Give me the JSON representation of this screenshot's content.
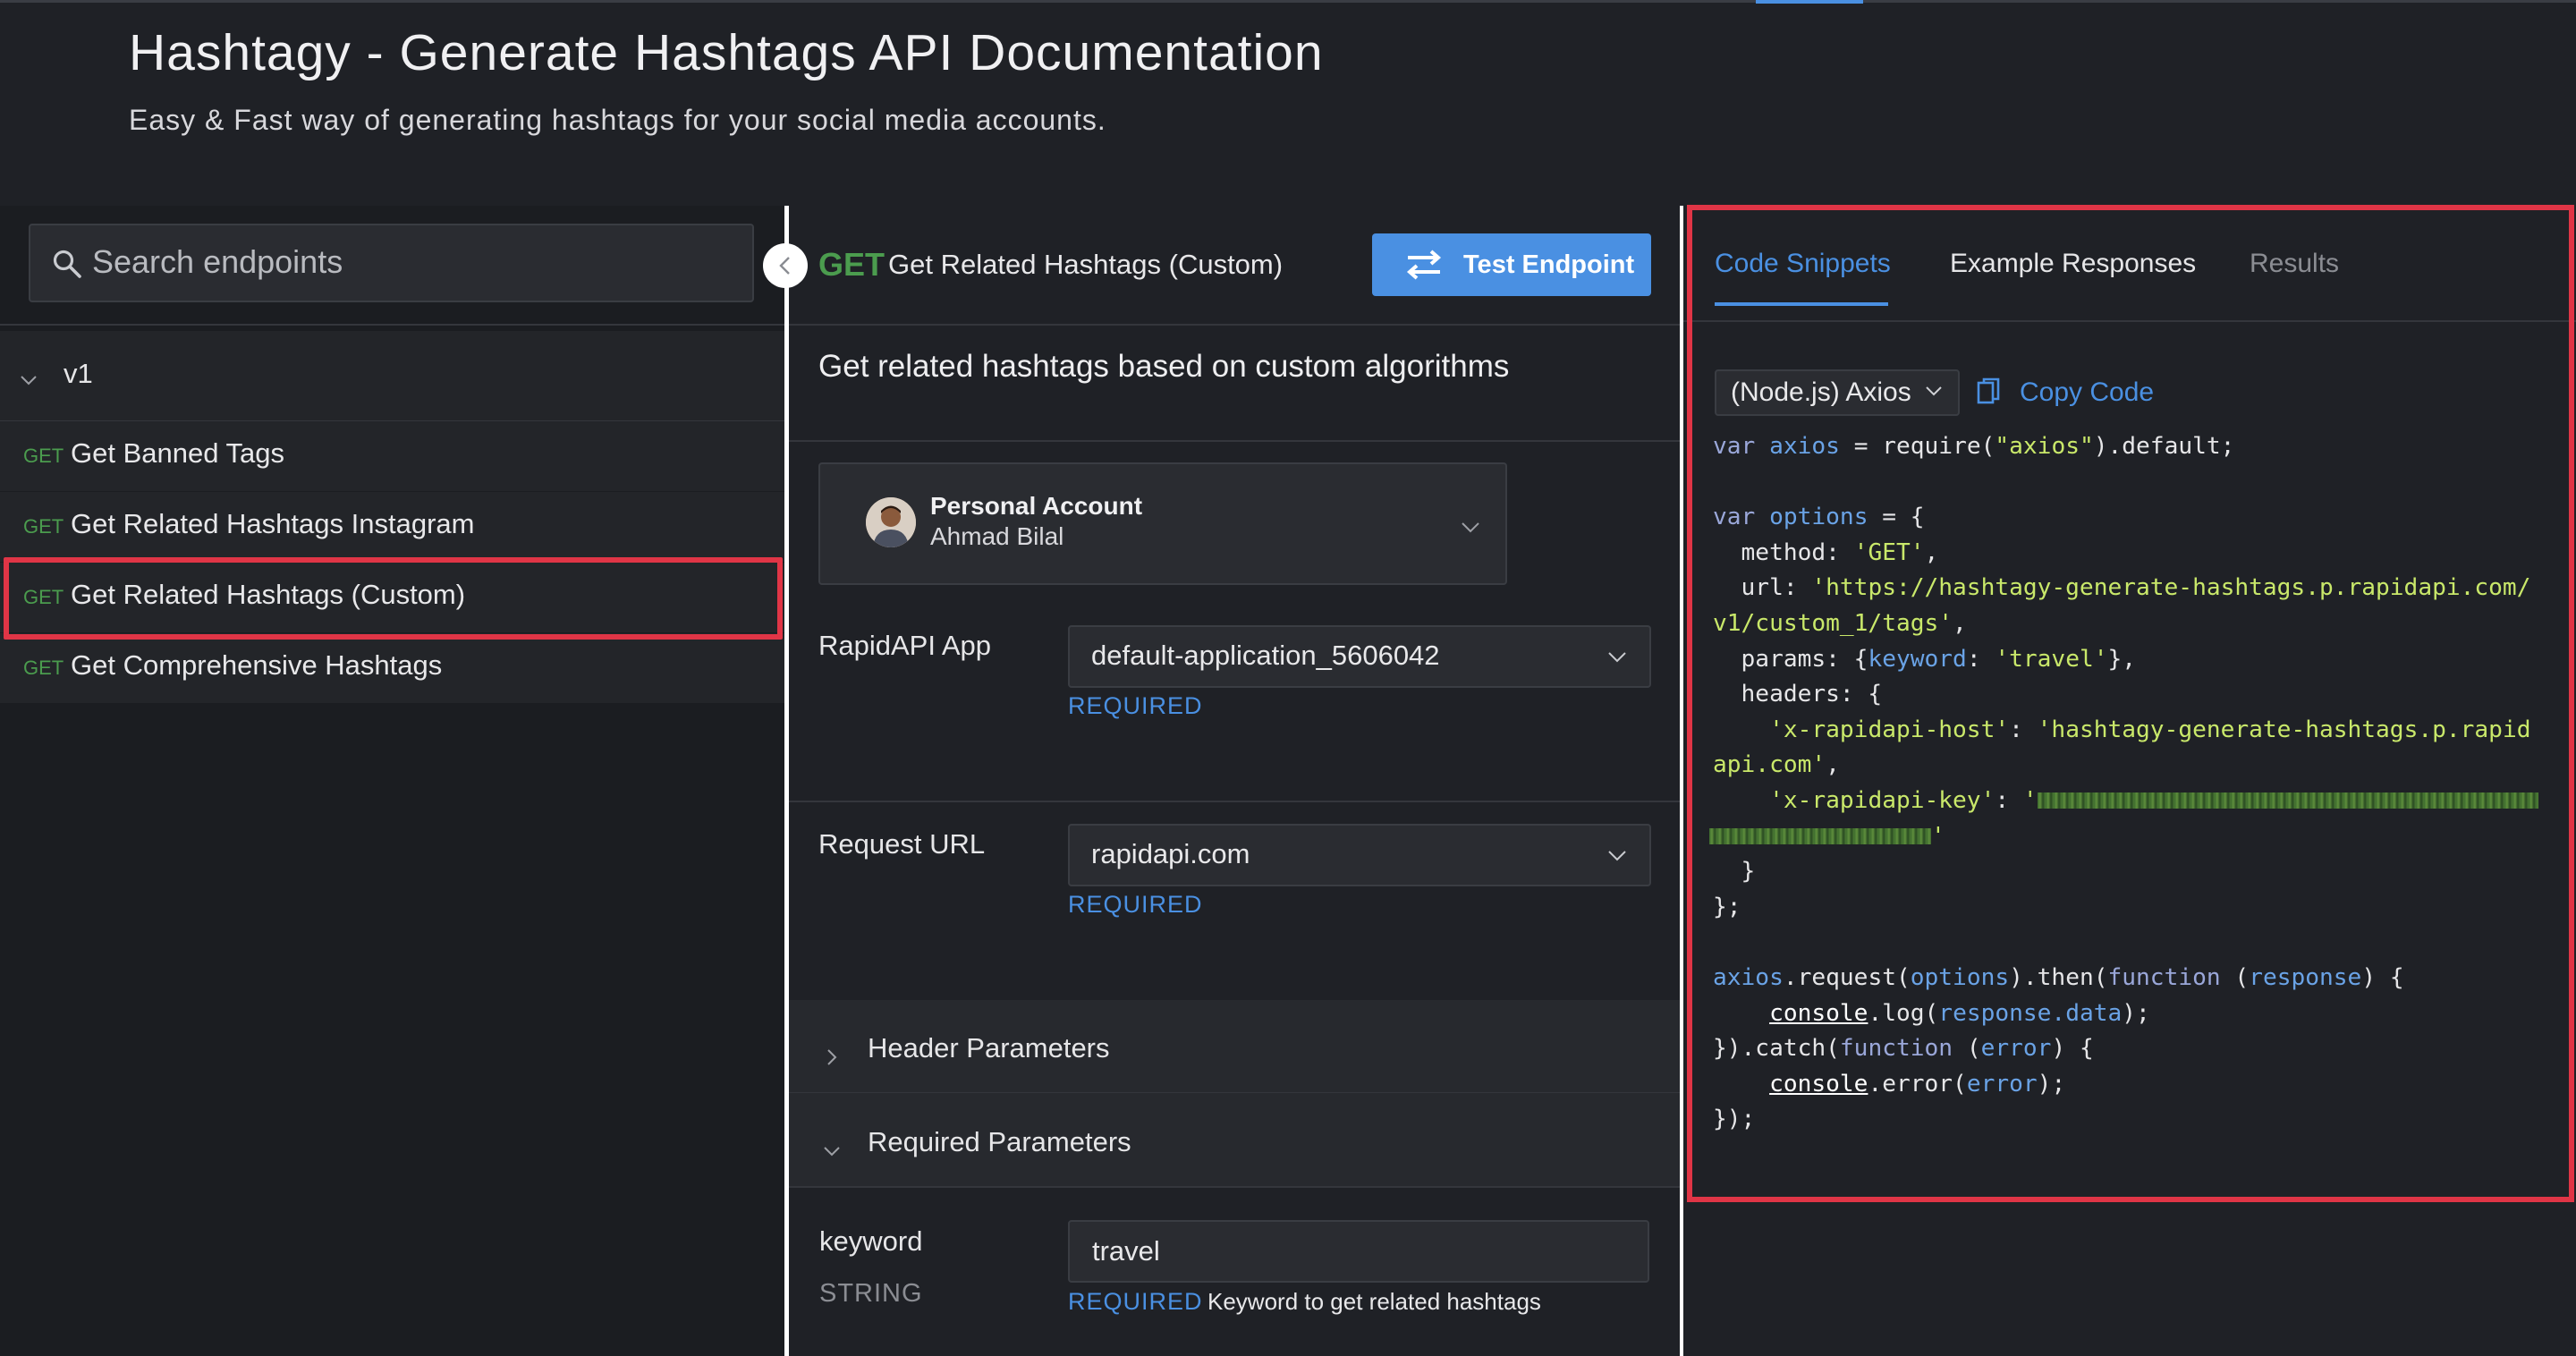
{
  "header": {
    "title": "Hashtagy - Generate Hashtags API Documentation",
    "subtitle": "Easy & Fast way of generating hashtags for your social media accounts."
  },
  "sidebar": {
    "search_placeholder": "Search endpoints",
    "group_label": "v1",
    "endpoints": [
      {
        "method": "GET",
        "name": "Get Banned Tags"
      },
      {
        "method": "GET",
        "name": "Get Related Hashtags Instagram"
      },
      {
        "method": "GET",
        "name": "Get Related Hashtags (Custom)",
        "selected": true
      },
      {
        "method": "GET",
        "name": "Get Comprehensive Hashtags"
      }
    ]
  },
  "endpoint": {
    "method": "GET",
    "name": "Get Related Hashtags (Custom)",
    "test_button": "Test Endpoint",
    "description": "Get related hashtags based on custom algorithms"
  },
  "account": {
    "type": "Personal Account",
    "user": "Ahmad Bilal"
  },
  "form": {
    "app_label": "RapidAPI App",
    "app_value": "default-application_5606042",
    "url_label": "Request URL",
    "url_value": "rapidapi.com",
    "required_label": "REQUIRED",
    "header_params_label": "Header Parameters",
    "required_params_label": "Required Parameters",
    "keyword_label": "keyword",
    "keyword_type": "STRING",
    "keyword_value": "travel",
    "keyword_description": "Keyword to get related hashtags"
  },
  "right_panel": {
    "tabs": [
      {
        "label": "Code Snippets",
        "active": true
      },
      {
        "label": "Example Responses",
        "active": false
      },
      {
        "label": "Results",
        "active": false
      }
    ],
    "language": "(Node.js) Axios",
    "copy_label": "Copy Code"
  },
  "code": {
    "line1_kw": "var",
    "line1_var": "axios",
    "line1_rest": " = require(",
    "line1_str": "\"axios\"",
    "line1_end": ").default;",
    "options_kw": "var",
    "options_var": "options",
    "options_rest": " = {",
    "method_key": "  method: ",
    "method_val": "'GET'",
    "url_key": "  url: ",
    "url_val_1": "'https://hashtagy-generate-hashtags.p.rapidapi.com/",
    "url_val_2": "v1/custom_1/tags'",
    "params_key": "  params: {",
    "params_inner_key": "keyword",
    "params_inner_val": "'travel'",
    "headers_key": "  headers: {",
    "host_key": "'x-rapidapi-host'",
    "host_val_1": "'hashtagy-generate-hashtags.p.rapid",
    "host_val_2": "api.com'",
    "key_key": "'x-rapidapi-key'",
    "key_val_open": "'",
    "key_val_close": "'",
    "close_headers": "  }",
    "close_options": "};",
    "request_prefix": "axios",
    "request_mid": ".request(",
    "request_arg": "options",
    "request_then": ").then(",
    "function_kw": "function",
    "response_arg": "response",
    "request_end": ") {",
    "console1": "console",
    "log_call": ".log(",
    "response_data": "response.data",
    "log_end": ");",
    "catch_line": "}).catch(",
    "error_arg": "error",
    "console2": "console",
    "error_call": ".error(",
    "error_end": ");",
    "final": "});"
  },
  "colors": {
    "accent": "#4a90e2",
    "method_get": "#4b9c4e",
    "highlight_outline": "#e03546"
  }
}
